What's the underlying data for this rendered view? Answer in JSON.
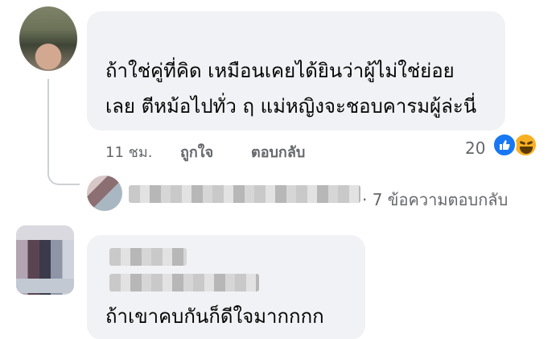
{
  "comments": [
    {
      "author_name": "",
      "text_line1": "ถ้าใช่คู่ที่คิด เหมือนเคยได้ยินว่าผู้ไม่ใช่ย่อย",
      "text_line2": "เลย ตีหม้อไปทั่ว ฤ แม่หญิงจะชอบคารมผู้ล่ะนี่",
      "time": "11 ชม.",
      "like_label": "ถูกใจ",
      "reply_label": "ตอบกลับ",
      "reaction_count": "20",
      "reactions": [
        "like-icon",
        "haha-icon"
      ]
    },
    {
      "author_name": "",
      "text": "ถ้าเขาคบกันก็ดีใจมากกกก"
    }
  ],
  "replies_preview": {
    "label": "· 7 ข้อความตอบกลับ"
  },
  "colors": {
    "bubble": "#f0f2f5",
    "meta_text": "#65676b",
    "like_blue": "#1877f2",
    "haha_yellow": "#f7b125"
  }
}
